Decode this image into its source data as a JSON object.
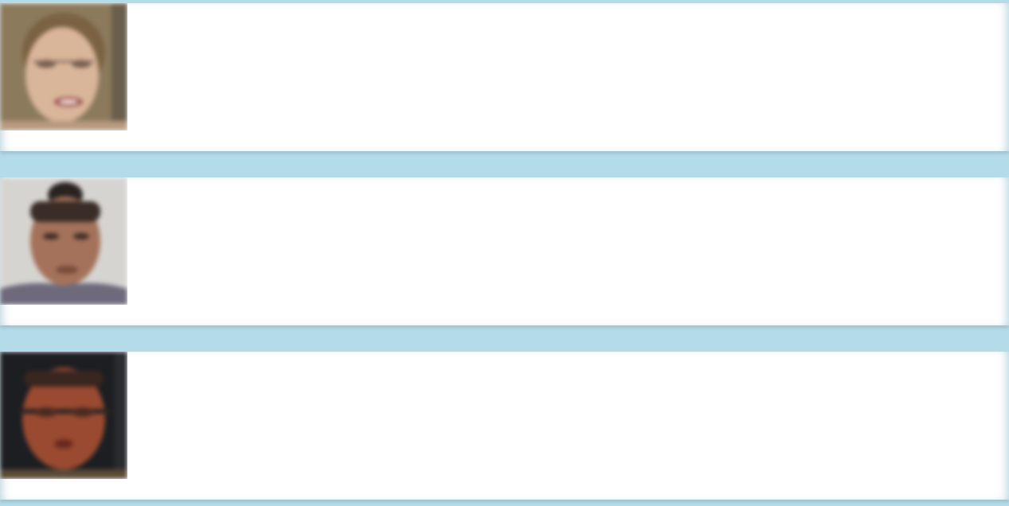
{
  "profiles": [
    {
      "name": "",
      "bio": "",
      "meta_1": "",
      "meta_2": "",
      "meta_3": ""
    },
    {
      "name": "",
      "bio": "",
      "meta_1": "",
      "meta_2": "",
      "meta_3": ""
    },
    {
      "name": "",
      "bio": "",
      "meta_1": "",
      "meta_2": "",
      "meta_3": ""
    }
  ],
  "colors": {
    "background": "#b4dbe8",
    "card": "#ffffff",
    "name_text": "#6a6a6a",
    "bio_text": "#8a8a8a",
    "link_text": "#8fb6b0"
  }
}
